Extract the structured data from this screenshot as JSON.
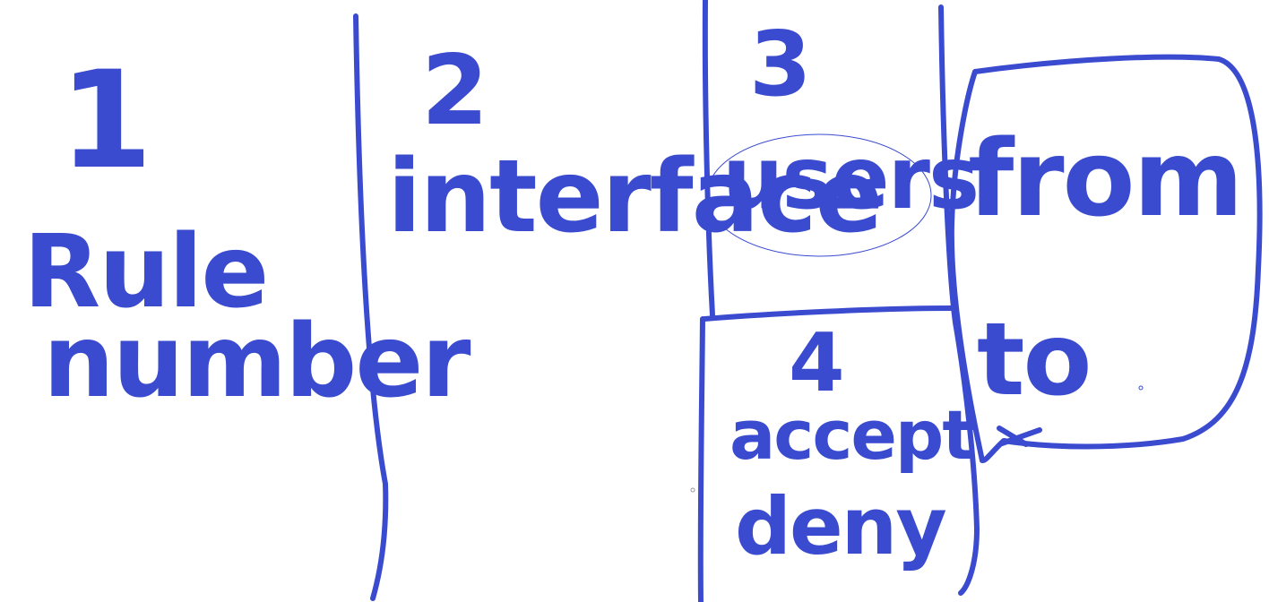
{
  "ink_color": "#3a4bd0",
  "background_color": "#ffffff",
  "columns": [
    {
      "number": "1",
      "label_line1": "Rule",
      "label_line2": "number"
    },
    {
      "number": "2",
      "label_line1": "interface"
    },
    {
      "number": "3",
      "label_line1": "users"
    },
    {
      "number": "4",
      "label_line1": "accept",
      "label_line2": "deny"
    }
  ],
  "direction": {
    "from_label": "from",
    "to_label": "to"
  }
}
